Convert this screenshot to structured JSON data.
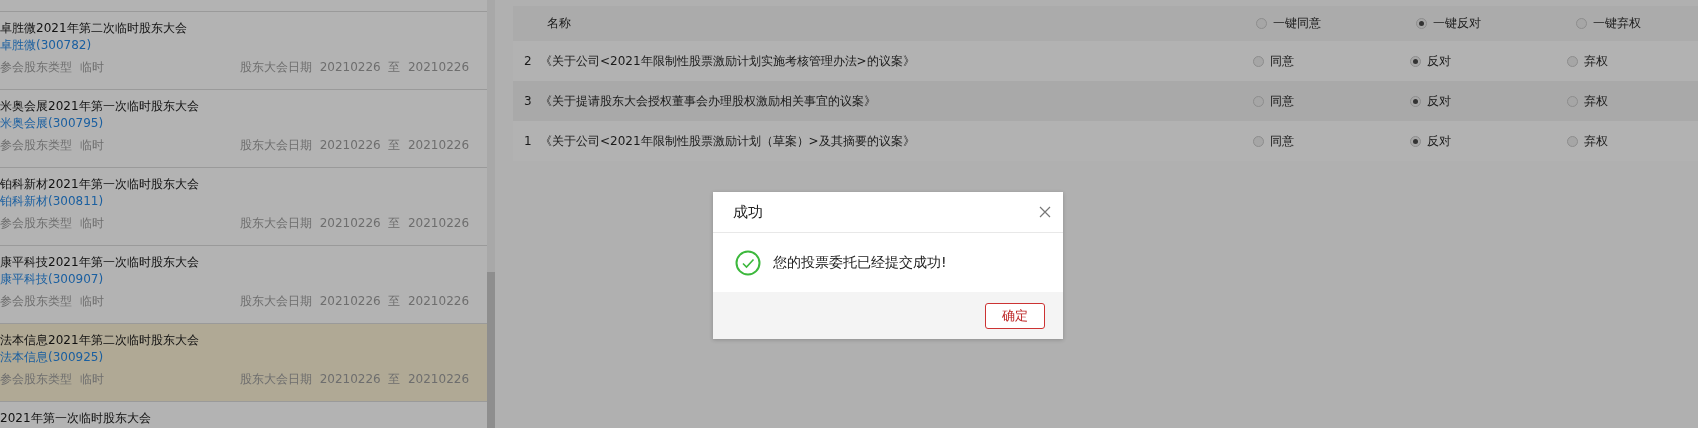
{
  "meetings": [
    {
      "title": "卓胜微2021年第二次临时股东大会",
      "company": "卓胜微(300782)",
      "type_label": "参会股东类型",
      "type": "临时",
      "date_label": "股东大会日期",
      "start": "20210226",
      "to": "至",
      "end": "20210226",
      "selected": false
    },
    {
      "title": "米奥会展2021年第一次临时股东大会",
      "company": "米奥会展(300795)",
      "type_label": "参会股东类型",
      "type": "临时",
      "date_label": "股东大会日期",
      "start": "20210226",
      "to": "至",
      "end": "20210226",
      "selected": false
    },
    {
      "title": "铂科新材2021年第一次临时股东大会",
      "company": "铂科新材(300811)",
      "type_label": "参会股东类型",
      "type": "临时",
      "date_label": "股东大会日期",
      "start": "20210226",
      "to": "至",
      "end": "20210226",
      "selected": false
    },
    {
      "title": "康平科技2021年第一次临时股东大会",
      "company": "康平科技(300907)",
      "type_label": "参会股东类型",
      "type": "临时",
      "date_label": "股东大会日期",
      "start": "20210226",
      "to": "至",
      "end": "20210226",
      "selected": false
    },
    {
      "title": "法本信息2021年第二次临时股东大会",
      "company": "法本信息(300925)",
      "type_label": "参会股东类型",
      "type": "临时",
      "date_label": "股东大会日期",
      "start": "20210226",
      "to": "至",
      "end": "20210226",
      "selected": true
    },
    {
      "title": "2021年第一次临时股东大会",
      "selected": false
    }
  ],
  "table": {
    "name_header": "名称",
    "bulk_options": [
      {
        "label": "一键同意",
        "selected": false
      },
      {
        "label": "一键反对",
        "selected": true
      },
      {
        "label": "一键弃权",
        "selected": false
      }
    ],
    "rows": [
      {
        "no": "2",
        "title": "《关于公司<2021年限制性股票激励计划实施考核管理办法>的议案》",
        "options": [
          {
            "label": "同意",
            "selected": false
          },
          {
            "label": "反对",
            "selected": true
          },
          {
            "label": "弃权",
            "selected": false
          }
        ]
      },
      {
        "no": "3",
        "title": "《关于提请股东大会授权董事会办理股权激励相关事宜的议案》",
        "options": [
          {
            "label": "同意",
            "selected": false
          },
          {
            "label": "反对",
            "selected": true
          },
          {
            "label": "弃权",
            "selected": false
          }
        ]
      },
      {
        "no": "1",
        "title": "《关于公司<2021年限制性股票激励计划（草案）>及其摘要的议案》",
        "options": [
          {
            "label": "同意",
            "selected": false
          },
          {
            "label": "反对",
            "selected": true
          },
          {
            "label": "弃权",
            "selected": false
          }
        ]
      }
    ]
  },
  "dialog": {
    "title": "成功",
    "message": "您的投票委托已经提交成功!",
    "ok": "确定"
  }
}
